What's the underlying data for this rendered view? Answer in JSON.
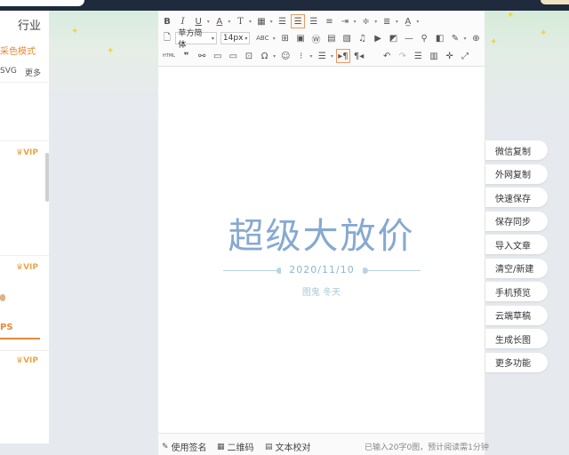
{
  "left_panel": {
    "industry_label": "行业",
    "mode_label": "采色模式",
    "svg_label": "SVG",
    "more_label": "更多",
    "vip_badges": [
      "VIP",
      "VIP",
      "VIP"
    ],
    "ps_label": "PS"
  },
  "toolbar": {
    "row1": [
      "bold-icon",
      "italic-icon",
      "underline-icon",
      "font-color-icon",
      "text-style-icon",
      "table-style-icon",
      "align-left-icon",
      "align-center-icon",
      "align-right-icon",
      "justify-icon",
      "indent-icon",
      "line-height-icon",
      "paragraph-spacing-icon",
      "letter-spacing-icon"
    ],
    "font_family": "苹方简体",
    "font_size": "14px",
    "abc_label": "ABC",
    "html_label": "HTML"
  },
  "document": {
    "title": "超级大放价",
    "date": "2020/11/10",
    "subtitle": "图鬼  冬天"
  },
  "statusbar": {
    "signature": "使用签名",
    "qrcode": "二维码",
    "proofread": "文本校对",
    "word_count": "已输入20字0图，预计阅读需1分钟"
  },
  "actions": [
    "微信复制",
    "外网复制",
    "快速保存",
    "保存同步",
    "导入文章",
    "清空/新建",
    "手机预览",
    "云端草稿",
    "生成长图",
    "更多功能"
  ],
  "colors": {
    "accent": "#e58a3a",
    "title": "#86a9d1",
    "topbar": "#1f2b3c"
  }
}
